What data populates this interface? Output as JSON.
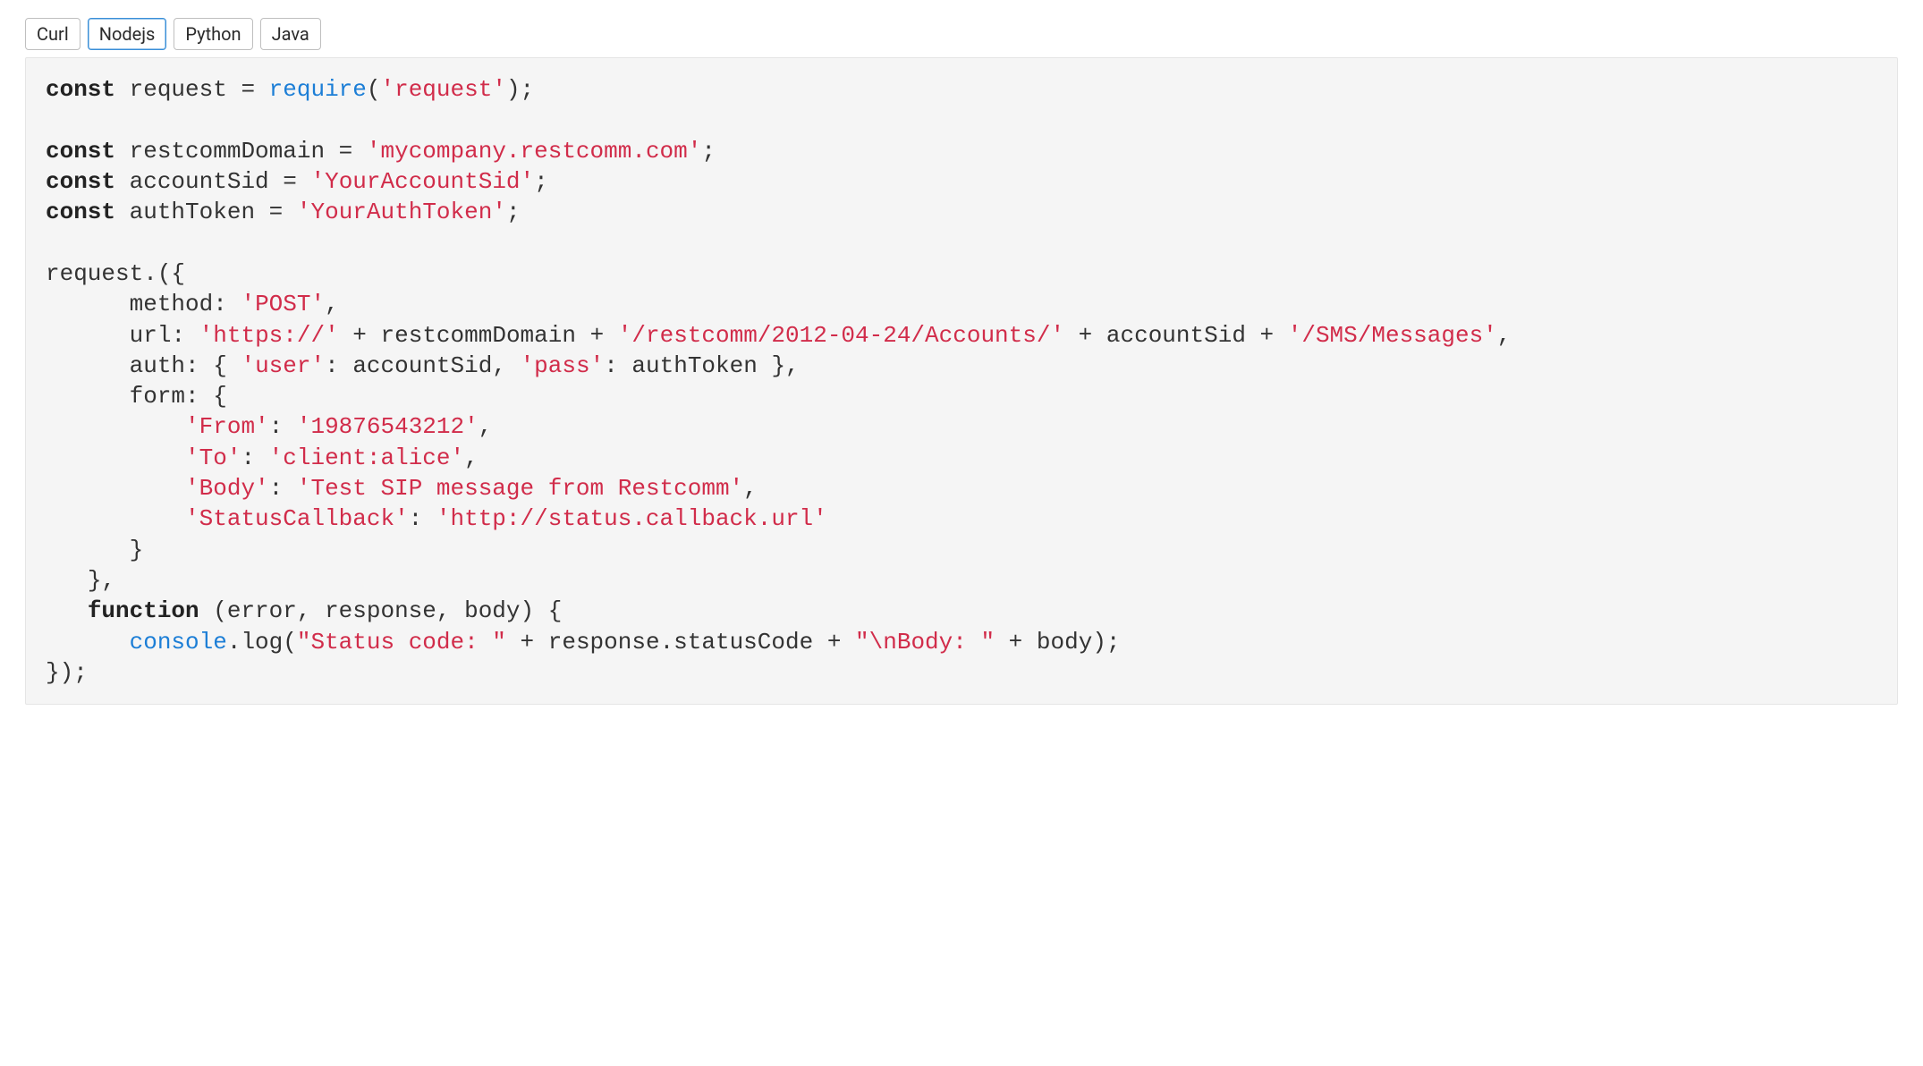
{
  "tabs": {
    "items": [
      {
        "label": "Curl",
        "active": false
      },
      {
        "label": "Nodejs",
        "active": true
      },
      {
        "label": "Python",
        "active": false
      },
      {
        "label": "Java",
        "active": false
      }
    ]
  },
  "code": {
    "require_fn": "require",
    "require_arg": "'request'",
    "const_kw": "const",
    "function_kw": "function",
    "var_request": "request",
    "var_restcommDomain": "restcommDomain",
    "var_accountSid": "accountSid",
    "var_authToken": "authToken",
    "val_restcommDomain": "'mycompany.restcomm.com'",
    "val_accountSid": "'YourAccountSid'",
    "val_authToken": "'YourAuthToken'",
    "key_method": "method",
    "val_method": "'POST'",
    "key_url": "url",
    "val_url_scheme": "'https://'",
    "val_url_path": "'/restcomm/2012-04-24/Accounts/'",
    "val_url_tail": "'/SMS/Messages'",
    "key_auth": "auth",
    "key_user": "'user'",
    "key_pass": "'pass'",
    "key_form": "form",
    "key_From": "'From'",
    "val_From": "'19876543212'",
    "key_To": "'To'",
    "val_To": "'client:alice'",
    "key_Body": "'Body'",
    "val_Body": "'Test SIP message from Restcomm'",
    "key_StatusCallback": "'StatusCallback'",
    "val_StatusCallback": "'http://status.callback.url'",
    "cb_params": "(error, response, body)",
    "console": "console",
    "log": "log",
    "log_str1": "\"Status code: \"",
    "resp_status": "response.statusCode",
    "log_str2": "\"\\nBody: \"",
    "body_var": "body"
  }
}
